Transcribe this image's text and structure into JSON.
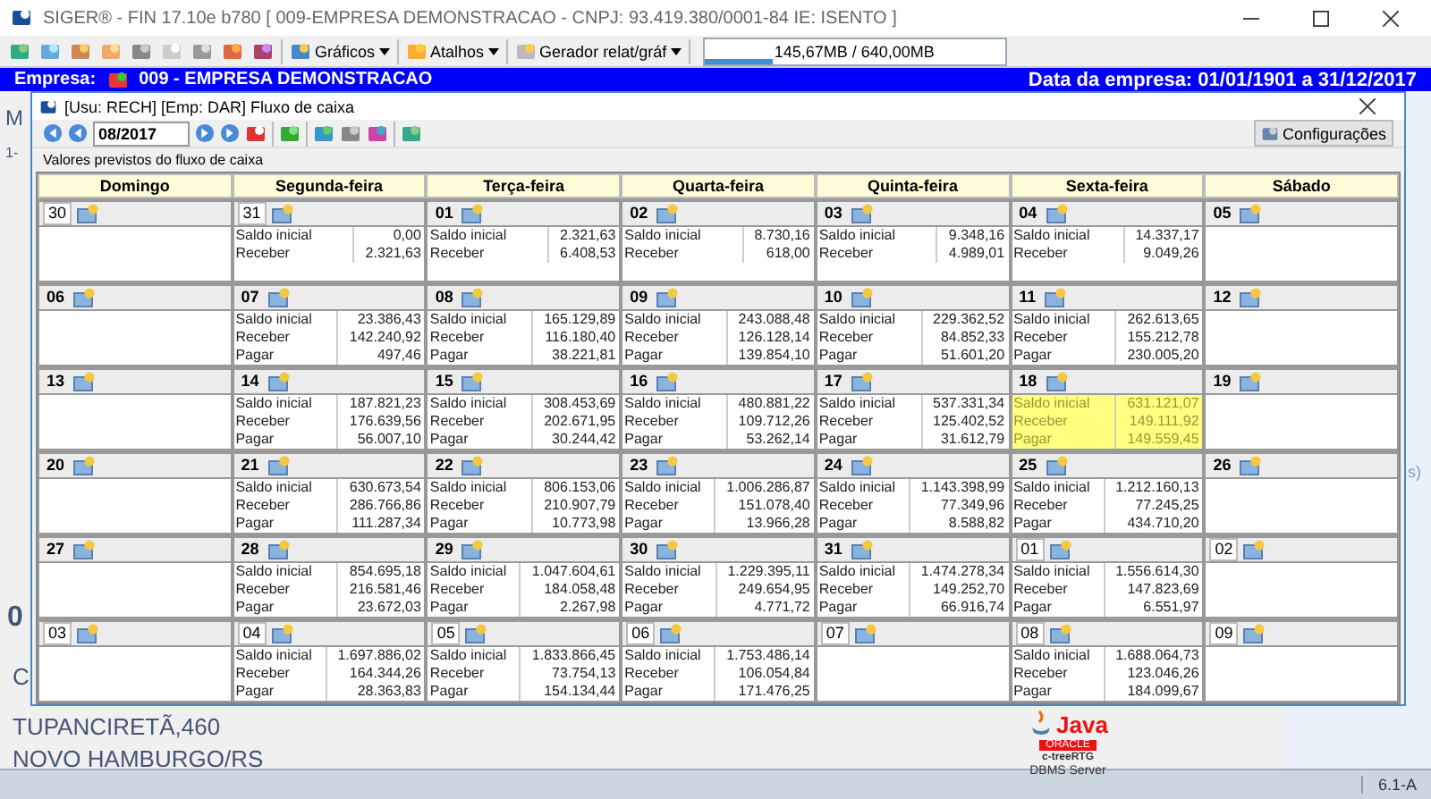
{
  "window": {
    "title": "SIGER® - FIN 17.10e b780 [ 009-EMPRESA DEMONSTRACAO - CNPJ: 93.419.380/0001-84 IE: ISENTO ]"
  },
  "toolbar": {
    "menus": [
      "Gráficos",
      "Atalhos",
      "Gerador relat/gráf"
    ],
    "memory": {
      "text": "145,67MB / 640,00MB",
      "level": 0.23
    }
  },
  "company_bar": {
    "label": "Empresa:",
    "name": "009 - EMPRESA DEMONSTRACAO",
    "dates": "Data da empresa: 01/01/1901 a 31/12/2017"
  },
  "background": {
    "texts_left": [
      "M",
      "1-"
    ],
    "number": "0",
    "letter": "C",
    "address": [
      "TUPANCIRETÃ,460",
      "NOVO HAMBURGO/RS"
    ],
    "text_right": "s)",
    "logo": {
      "java": "Java",
      "oracle": "ORACLE",
      "ctree": "c-treeRTG",
      "caption": "DBMS Server"
    }
  },
  "status_bar": {
    "version": "6.1-A"
  },
  "dialog": {
    "title": "[Usu: RECH] [Emp: DAR] Fluxo de caixa",
    "month": "08/2017",
    "settings_button": "Configurações",
    "caption": "Valores previstos do fluxo de caixa",
    "weekdays": [
      "Domingo",
      "Segunda-feira",
      "Terça-feira",
      "Quarta-feira",
      "Quinta-feira",
      "Sexta-feira",
      "Sábado"
    ],
    "weeks": [
      [
        {
          "day": "30",
          "in_month": false,
          "highlighted": false
        },
        {
          "day": "31",
          "in_month": false,
          "highlighted": false,
          "entries": [
            {
              "label": "Saldo inicial",
              "value": "0,00"
            },
            {
              "label": "Receber",
              "value": "2.321,63"
            }
          ]
        },
        {
          "day": "01",
          "in_month": true,
          "highlighted": false,
          "entries": [
            {
              "label": "Saldo inicial",
              "value": "2.321,63"
            },
            {
              "label": "Receber",
              "value": "6.408,53"
            }
          ]
        },
        {
          "day": "02",
          "in_month": true,
          "highlighted": false,
          "entries": [
            {
              "label": "Saldo inicial",
              "value": "8.730,16"
            },
            {
              "label": "Receber",
              "value": "618,00"
            }
          ]
        },
        {
          "day": "03",
          "in_month": true,
          "highlighted": false,
          "entries": [
            {
              "label": "Saldo inicial",
              "value": "9.348,16"
            },
            {
              "label": "Receber",
              "value": "4.989,01"
            }
          ]
        },
        {
          "day": "04",
          "in_month": true,
          "highlighted": false,
          "entries": [
            {
              "label": "Saldo inicial",
              "value": "14.337,17"
            },
            {
              "label": "Receber",
              "value": "9.049,26"
            }
          ]
        },
        {
          "day": "05",
          "in_month": true,
          "highlighted": false
        }
      ],
      [
        {
          "day": "06",
          "in_month": true,
          "highlighted": false
        },
        {
          "day": "07",
          "in_month": true,
          "highlighted": false,
          "entries": [
            {
              "label": "Saldo inicial",
              "value": "23.386,43"
            },
            {
              "label": "Receber",
              "value": "142.240,92"
            },
            {
              "label": "Pagar",
              "value": "497,46"
            }
          ]
        },
        {
          "day": "08",
          "in_month": true,
          "highlighted": false,
          "entries": [
            {
              "label": "Saldo inicial",
              "value": "165.129,89"
            },
            {
              "label": "Receber",
              "value": "116.180,40"
            },
            {
              "label": "Pagar",
              "value": "38.221,81"
            }
          ]
        },
        {
          "day": "09",
          "in_month": true,
          "highlighted": false,
          "entries": [
            {
              "label": "Saldo inicial",
              "value": "243.088,48"
            },
            {
              "label": "Receber",
              "value": "126.128,14"
            },
            {
              "label": "Pagar",
              "value": "139.854,10"
            }
          ]
        },
        {
          "day": "10",
          "in_month": true,
          "highlighted": false,
          "entries": [
            {
              "label": "Saldo inicial",
              "value": "229.362,52"
            },
            {
              "label": "Receber",
              "value": "84.852,33"
            },
            {
              "label": "Pagar",
              "value": "51.601,20"
            }
          ]
        },
        {
          "day": "11",
          "in_month": true,
          "highlighted": false,
          "entries": [
            {
              "label": "Saldo inicial",
              "value": "262.613,65"
            },
            {
              "label": "Receber",
              "value": "155.212,78"
            },
            {
              "label": "Pagar",
              "value": "230.005,20"
            }
          ]
        },
        {
          "day": "12",
          "in_month": true,
          "highlighted": false
        }
      ],
      [
        {
          "day": "13",
          "in_month": true,
          "highlighted": false
        },
        {
          "day": "14",
          "in_month": true,
          "highlighted": false,
          "entries": [
            {
              "label": "Saldo inicial",
              "value": "187.821,23"
            },
            {
              "label": "Receber",
              "value": "176.639,56"
            },
            {
              "label": "Pagar",
              "value": "56.007,10"
            }
          ]
        },
        {
          "day": "15",
          "in_month": true,
          "highlighted": false,
          "entries": [
            {
              "label": "Saldo inicial",
              "value": "308.453,69"
            },
            {
              "label": "Receber",
              "value": "202.671,95"
            },
            {
              "label": "Pagar",
              "value": "30.244,42"
            }
          ]
        },
        {
          "day": "16",
          "in_month": true,
          "highlighted": false,
          "entries": [
            {
              "label": "Saldo inicial",
              "value": "480.881,22"
            },
            {
              "label": "Receber",
              "value": "109.712,26"
            },
            {
              "label": "Pagar",
              "value": "53.262,14"
            }
          ]
        },
        {
          "day": "17",
          "in_month": true,
          "highlighted": false,
          "entries": [
            {
              "label": "Saldo inicial",
              "value": "537.331,34"
            },
            {
              "label": "Receber",
              "value": "125.402,52"
            },
            {
              "label": "Pagar",
              "value": "31.612,79"
            }
          ]
        },
        {
          "day": "18",
          "in_month": true,
          "highlighted": true,
          "entries": [
            {
              "label": "Saldo inicial",
              "value": "631.121,07"
            },
            {
              "label": "Receber",
              "value": "149.111,92"
            },
            {
              "label": "Pagar",
              "value": "149.559,45"
            }
          ]
        },
        {
          "day": "19",
          "in_month": true,
          "highlighted": false
        }
      ],
      [
        {
          "day": "20",
          "in_month": true,
          "highlighted": false
        },
        {
          "day": "21",
          "in_month": true,
          "highlighted": false,
          "entries": [
            {
              "label": "Saldo inicial",
              "value": "630.673,54"
            },
            {
              "label": "Receber",
              "value": "286.766,86"
            },
            {
              "label": "Pagar",
              "value": "111.287,34"
            }
          ]
        },
        {
          "day": "22",
          "in_month": true,
          "highlighted": false,
          "entries": [
            {
              "label": "Saldo inicial",
              "value": "806.153,06"
            },
            {
              "label": "Receber",
              "value": "210.907,79"
            },
            {
              "label": "Pagar",
              "value": "10.773,98"
            }
          ]
        },
        {
          "day": "23",
          "in_month": true,
          "highlighted": false,
          "entries": [
            {
              "label": "Saldo inicial",
              "value": "1.006.286,87"
            },
            {
              "label": "Receber",
              "value": "151.078,40"
            },
            {
              "label": "Pagar",
              "value": "13.966,28"
            }
          ]
        },
        {
          "day": "24",
          "in_month": true,
          "highlighted": false,
          "entries": [
            {
              "label": "Saldo inicial",
              "value": "1.143.398,99"
            },
            {
              "label": "Receber",
              "value": "77.349,96"
            },
            {
              "label": "Pagar",
              "value": "8.588,82"
            }
          ]
        },
        {
          "day": "25",
          "in_month": true,
          "highlighted": false,
          "entries": [
            {
              "label": "Saldo inicial",
              "value": "1.212.160,13"
            },
            {
              "label": "Receber",
              "value": "77.245,25"
            },
            {
              "label": "Pagar",
              "value": "434.710,20"
            }
          ]
        },
        {
          "day": "26",
          "in_month": true,
          "highlighted": false
        }
      ],
      [
        {
          "day": "27",
          "in_month": true,
          "highlighted": false
        },
        {
          "day": "28",
          "in_month": true,
          "highlighted": false,
          "entries": [
            {
              "label": "Saldo inicial",
              "value": "854.695,18"
            },
            {
              "label": "Receber",
              "value": "216.581,46"
            },
            {
              "label": "Pagar",
              "value": "23.672,03"
            }
          ]
        },
        {
          "day": "29",
          "in_month": true,
          "highlighted": false,
          "entries": [
            {
              "label": "Saldo inicial",
              "value": "1.047.604,61"
            },
            {
              "label": "Receber",
              "value": "184.058,48"
            },
            {
              "label": "Pagar",
              "value": "2.267,98"
            }
          ]
        },
        {
          "day": "30",
          "in_month": true,
          "highlighted": false,
          "entries": [
            {
              "label": "Saldo inicial",
              "value": "1.229.395,11"
            },
            {
              "label": "Receber",
              "value": "249.654,95"
            },
            {
              "label": "Pagar",
              "value": "4.771,72"
            }
          ]
        },
        {
          "day": "31",
          "in_month": true,
          "highlighted": false,
          "entries": [
            {
              "label": "Saldo inicial",
              "value": "1.474.278,34"
            },
            {
              "label": "Receber",
              "value": "149.252,70"
            },
            {
              "label": "Pagar",
              "value": "66.916,74"
            }
          ]
        },
        {
          "day": "01",
          "in_month": false,
          "highlighted": false,
          "entries": [
            {
              "label": "Saldo inicial",
              "value": "1.556.614,30"
            },
            {
              "label": "Receber",
              "value": "147.823,69"
            },
            {
              "label": "Pagar",
              "value": "6.551,97"
            }
          ]
        },
        {
          "day": "02",
          "in_month": false,
          "highlighted": false
        }
      ],
      [
        {
          "day": "03",
          "in_month": false,
          "highlighted": false
        },
        {
          "day": "04",
          "in_month": false,
          "highlighted": false,
          "entries": [
            {
              "label": "Saldo inicial",
              "value": "1.697.886,02"
            },
            {
              "label": "Receber",
              "value": "164.344,26"
            },
            {
              "label": "Pagar",
              "value": "28.363,83"
            }
          ]
        },
        {
          "day": "05",
          "in_month": false,
          "highlighted": false,
          "entries": [
            {
              "label": "Saldo inicial",
              "value": "1.833.866,45"
            },
            {
              "label": "Receber",
              "value": "73.754,13"
            },
            {
              "label": "Pagar",
              "value": "154.134,44"
            }
          ]
        },
        {
          "day": "06",
          "in_month": false,
          "highlighted": false,
          "entries": [
            {
              "label": "Saldo inicial",
              "value": "1.753.486,14"
            },
            {
              "label": "Receber",
              "value": "106.054,84"
            },
            {
              "label": "Pagar",
              "value": "171.476,25"
            }
          ]
        },
        {
          "day": "07",
          "in_month": false,
          "highlighted": false
        },
        {
          "day": "08",
          "in_month": false,
          "highlighted": false,
          "entries": [
            {
              "label": "Saldo inicial",
              "value": "1.688.064,73"
            },
            {
              "label": "Receber",
              "value": "123.046,26"
            },
            {
              "label": "Pagar",
              "value": "184.099,67"
            }
          ]
        },
        {
          "day": "09",
          "in_month": false,
          "highlighted": false
        }
      ]
    ]
  }
}
